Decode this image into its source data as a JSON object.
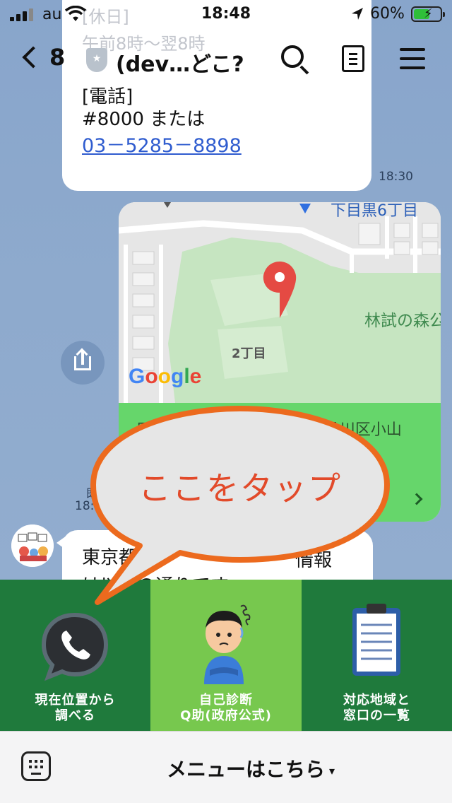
{
  "status_bar": {
    "carrier": "au",
    "time": "18:48",
    "battery": "60%"
  },
  "header": {
    "back_count": "8",
    "title": "(dev…どこ?"
  },
  "message1": {
    "faded_line1": "[休日]",
    "faded_line2": "午前8時～翌8時",
    "faded_line3": "[電話]",
    "line1": "#8000 または",
    "link": "03－5285－8898",
    "time": "18:30"
  },
  "map": {
    "top_label": "下目黒6丁目",
    "area_label": "林試の森公",
    "block_label": "2丁目",
    "address": "日本、〒142-0062 東京都品川区小山",
    "brand": [
      "G",
      "o",
      "o",
      "g",
      "l",
      "e"
    ]
  },
  "partial_time": {
    "line1": "既",
    "line2": "18:3"
  },
  "message2": {
    "part1": "東京都",
    "part2": "情報",
    "part3": "は以下の通りです。"
  },
  "rich_menu": {
    "items": [
      {
        "line1": "現在位置から",
        "line2": "調べる"
      },
      {
        "line1": "自己診断",
        "line2": "Q助(政府公式)"
      },
      {
        "line1": "対応地域と",
        "line2": "窓口の一覧"
      }
    ]
  },
  "bottom_bar": {
    "menu_label": "メニューはこちら",
    "menu_caret": "▾"
  },
  "callout": {
    "text": "ここをタップ"
  },
  "colors": {
    "chat_bg": "#8da9cd",
    "rich_menu_dark": "#1f7a3c",
    "rich_menu_light": "#77c84e",
    "map_footer": "#66d66b",
    "callout_border": "#ec6a1e",
    "callout_text": "#e24a2a",
    "link": "#2f5ccf"
  }
}
